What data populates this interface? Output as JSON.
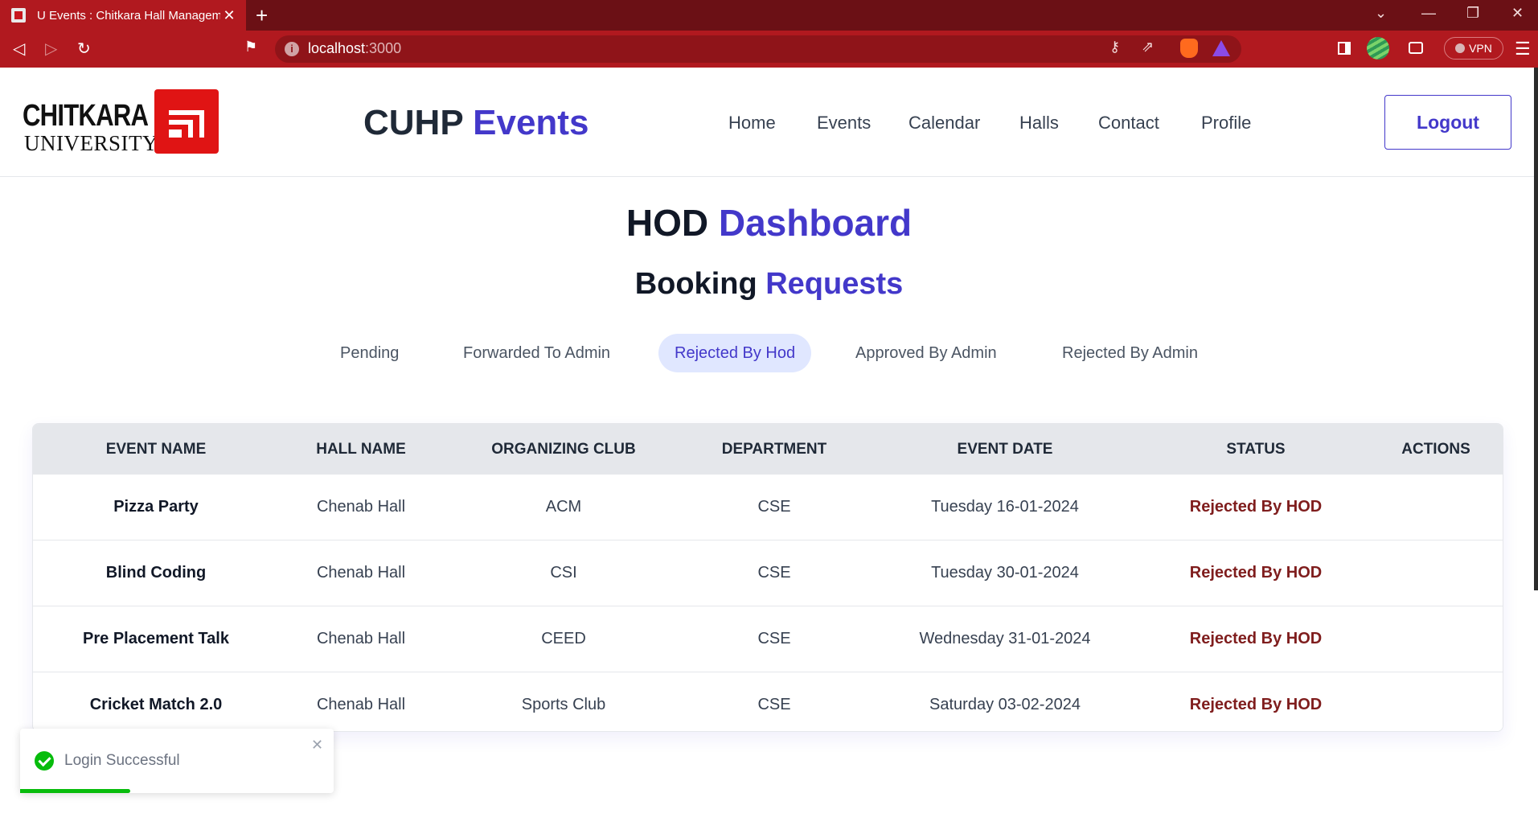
{
  "browser": {
    "tab_title": "U Events : Chitkara Hall Management",
    "url_host": "localhost",
    "url_port": ":3000",
    "vpn_label": "VPN"
  },
  "header": {
    "logo_word1": "CHITKARA",
    "logo_word2": "UNIVERSITY",
    "brand_main": "CUHP",
    "brand_accent": "Events",
    "nav": [
      "Home",
      "Events",
      "Calendar",
      "Halls",
      "Contact",
      "Profile"
    ],
    "logout_label": "Logout"
  },
  "dashboard": {
    "title_main": "HOD",
    "title_accent": "Dashboard",
    "subtitle_main": "Booking",
    "subtitle_accent": "Requests"
  },
  "filters": [
    "Pending",
    "Forwarded To Admin",
    "Rejected By Hod",
    "Approved By Admin",
    "Rejected By Admin"
  ],
  "active_filter": "Rejected By Hod",
  "table": {
    "columns": [
      "EVENT NAME",
      "HALL NAME",
      "ORGANIZING CLUB",
      "DEPARTMENT",
      "EVENT DATE",
      "STATUS",
      "ACTIONS"
    ],
    "rows": [
      {
        "event": "Pizza Party",
        "hall": "Chenab Hall",
        "club": "ACM",
        "dept": "CSE",
        "date": "Tuesday 16-01-2024",
        "status": "Rejected By HOD"
      },
      {
        "event": "Blind Coding",
        "hall": "Chenab Hall",
        "club": "CSI",
        "dept": "CSE",
        "date": "Tuesday 30-01-2024",
        "status": "Rejected By HOD"
      },
      {
        "event": "Pre Placement Talk",
        "hall": "Chenab Hall",
        "club": "CEED",
        "dept": "CSE",
        "date": "Wednesday 31-01-2024",
        "status": "Rejected By HOD"
      },
      {
        "event": "Cricket Match 2.0",
        "hall": "Chenab Hall",
        "club": "Sports Club",
        "dept": "CSE",
        "date": "Saturday 03-02-2024",
        "status": "Rejected By HOD"
      }
    ]
  },
  "toast": {
    "message": "Login Successful",
    "progress": 0.35
  },
  "colors": {
    "accent": "#4338ca",
    "status_rejected": "#7f1d1d",
    "browser_bar": "#b1191f",
    "toast_success": "#07bc0c"
  }
}
